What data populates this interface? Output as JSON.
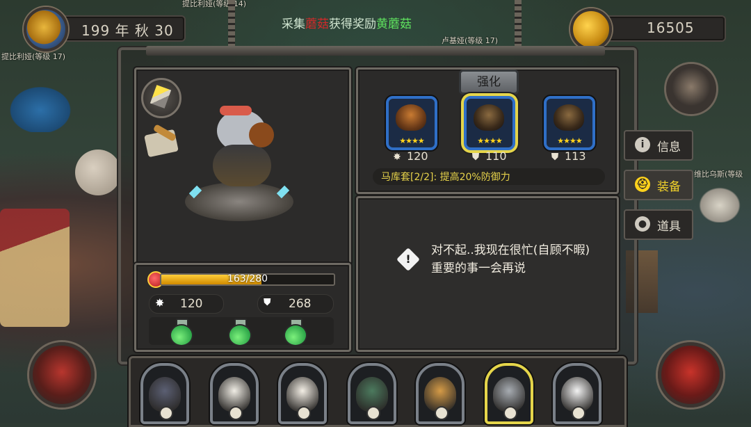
{
  "top": {
    "date": "199 年 秋 30",
    "gold": "16505",
    "quest": {
      "prefix": "采集",
      "item_red": "蘑菇",
      "middle": "获得奖励",
      "reward": "黄蘑菇"
    }
  },
  "npcs": [
    {
      "label": "提比利娅(等级 14)"
    },
    {
      "label": "提比利娅(等级 17)"
    },
    {
      "label": "卢基娅(等级 17)"
    },
    {
      "label": "维比乌斯(等级"
    }
  ],
  "character": {
    "hp_text": "163/280",
    "hp_fraction": 0.582,
    "attack": "120",
    "defense": "268",
    "potions": [
      "green-potion",
      "green-potion",
      "green-potion"
    ]
  },
  "equipment": {
    "upgrade_button": "强化",
    "slots": [
      {
        "stars": "★★★★",
        "stat_icon": "attack-icon",
        "stat": "120",
        "selected": false
      },
      {
        "stars": "★★★★",
        "stat_icon": "defense-icon",
        "stat": "110",
        "selected": true
      },
      {
        "stars": "★★★★",
        "stat_icon": "defense-icon",
        "stat": "113",
        "selected": false
      }
    ],
    "set_bonus": "马库套[2/2]: 提高20%防御力"
  },
  "message": "对不起..我现在很忙(自顾不暇)重要的事一会再说",
  "tabs": [
    {
      "label": "信息",
      "icon": "info-icon",
      "active": false
    },
    {
      "label": "装备",
      "icon": "helmet-icon",
      "active": true
    },
    {
      "label": "道具",
      "icon": "bag-icon",
      "active": false
    }
  ],
  "heroes": [
    {
      "name": "hero-boar",
      "color": "#5b5f73",
      "selected": false
    },
    {
      "name": "hero-eagle",
      "color": "#f0ede5",
      "selected": false
    },
    {
      "name": "hero-alpaca",
      "color": "#f3eee5",
      "selected": false
    },
    {
      "name": "hero-crocodile",
      "color": "#4c7a5e",
      "selected": false
    },
    {
      "name": "hero-giraffe",
      "color": "#d59b47",
      "selected": false
    },
    {
      "name": "hero-elephant",
      "color": "#a7acb2",
      "selected": true
    },
    {
      "name": "hero-polar-bear",
      "color": "#f2f2f2",
      "selected": false
    }
  ],
  "colors": {
    "accent": "#ffd21c",
    "hp": "#e8a50a",
    "slot_border": "#2f6fc7"
  }
}
